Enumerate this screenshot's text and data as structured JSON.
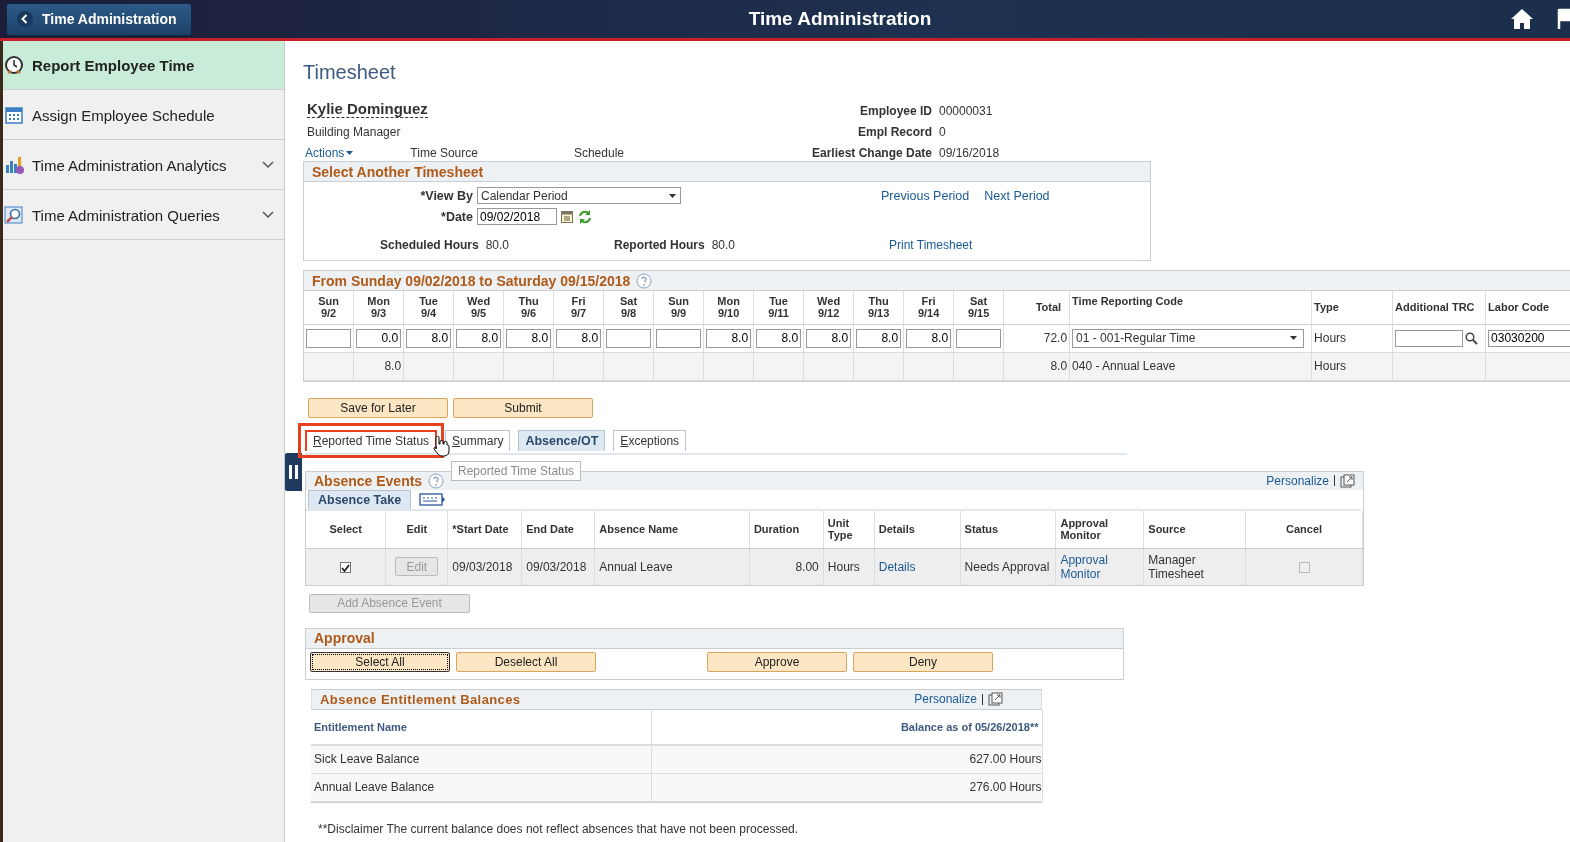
{
  "header": {
    "back_label": "Time Administration",
    "title": "Time Administration"
  },
  "sidebar": {
    "items": [
      {
        "label": "Report Employee Time",
        "selected": true,
        "expandable": false
      },
      {
        "label": "Assign Employee Schedule",
        "selected": false,
        "expandable": false
      },
      {
        "label": "Time Administration Analytics",
        "selected": false,
        "expandable": true
      },
      {
        "label": "Time Administration Queries",
        "selected": false,
        "expandable": true
      }
    ]
  },
  "page_title": "Timesheet",
  "employee": {
    "name": "Kylie Dominguez",
    "job_title": "Building Manager",
    "actions": "Actions",
    "time_source": "Time Source",
    "schedule": "Schedule",
    "fields": [
      {
        "label": "Employee ID",
        "value": "00000031"
      },
      {
        "label": "Empl Record",
        "value": "0"
      },
      {
        "label": "Earliest Change Date",
        "value": "09/16/2018"
      }
    ]
  },
  "select_timesheet": {
    "title": "Select Another Timesheet",
    "view_by_label": "*View By",
    "view_by": "Calendar Period",
    "date_label": "*Date",
    "date": "09/02/2018",
    "previous": "Previous Period",
    "next": "Next Period",
    "scheduled_label": "Scheduled Hours",
    "scheduled": "80.0",
    "reported_label": "Reported Hours",
    "reported": "80.0",
    "print": "Print Timesheet"
  },
  "grid": {
    "title": "From Sunday 09/02/2018 to Saturday 09/15/2018",
    "days": [
      {
        "dow": "Sun",
        "date": "9/2"
      },
      {
        "dow": "Mon",
        "date": "9/3"
      },
      {
        "dow": "Tue",
        "date": "9/4"
      },
      {
        "dow": "Wed",
        "date": "9/5"
      },
      {
        "dow": "Thu",
        "date": "9/6"
      },
      {
        "dow": "Fri",
        "date": "9/7"
      },
      {
        "dow": "Sat",
        "date": "9/8"
      },
      {
        "dow": "Sun",
        "date": "9/9"
      },
      {
        "dow": "Mon",
        "date": "9/10"
      },
      {
        "dow": "Tue",
        "date": "9/11"
      },
      {
        "dow": "Wed",
        "date": "9/12"
      },
      {
        "dow": "Thu",
        "date": "9/13"
      },
      {
        "dow": "Fri",
        "date": "9/14"
      },
      {
        "dow": "Sat",
        "date": "9/15"
      }
    ],
    "columns": [
      "Total",
      "Time Reporting Code",
      "Type",
      "Additional TRC",
      "Labor Code"
    ],
    "rows": [
      {
        "kind": "input",
        "hours": {
          "1": "0.0",
          "2": "8.0",
          "3": "8.0",
          "4": "8.0",
          "5": "8.0",
          "8": "8.0",
          "9": "8.0",
          "10": "8.0",
          "11": "8.0",
          "12": "8.0"
        },
        "total": "72.0",
        "trc": "01 - 001-Regular Time",
        "type": "Hours",
        "labor_code": "03030200"
      },
      {
        "kind": "readonly",
        "hours": {
          "1": "8.0"
        },
        "total": "8.0",
        "trc": "040 - Annual Leave",
        "type": "Hours"
      }
    ]
  },
  "buttons": [
    "Save for Later",
    "Submit"
  ],
  "tabs": [
    {
      "label": "Reported Time Status",
      "selected": false,
      "highlighted": true
    },
    {
      "label": "Summary",
      "selected": false,
      "highlighted": false
    },
    {
      "label": "Absence/OT",
      "selected": true,
      "highlighted": false
    },
    {
      "label": "Exceptions",
      "selected": false,
      "highlighted": false
    }
  ],
  "tooltip": "Reported Time Status",
  "absence_events": {
    "title": "Absence Events",
    "personalize": "Personalize",
    "subtab": "Absence Take",
    "columns": [
      "Select",
      "Edit",
      "*Start Date",
      "End Date",
      "Absence Name",
      "Duration",
      "Unit Type",
      "Details",
      "Status",
      "Approval Monitor",
      "Source",
      "Cancel"
    ],
    "rows": [
      {
        "selected": true,
        "edit": "Edit",
        "start": "09/03/2018",
        "end": "09/03/2018",
        "name": "Annual Leave",
        "duration": "8.00",
        "unit": "Hours",
        "details": "Details",
        "status": "Needs Approval",
        "monitor": "Approval Monitor",
        "source": "Manager Timesheet",
        "cancel": false
      }
    ]
  },
  "add_absence": {
    "label": "Add Absence Event",
    "disabled": true
  },
  "approval": {
    "title": "Approval",
    "buttons": [
      {
        "label": "Select All",
        "focused": true
      },
      {
        "label": "Deselect All",
        "focused": false
      },
      {
        "label": "Approve",
        "focused": false
      },
      {
        "label": "Deny",
        "focused": false
      }
    ]
  },
  "balances": {
    "title": "Absence Entitlement Balances",
    "personalize": "Personalize",
    "columns": [
      "Entitlement Name",
      "Balance as of 05/26/2018**"
    ],
    "rows": [
      {
        "name": "Sick Leave Balance",
        "balance": "627.00 Hours"
      },
      {
        "name": "Annual Leave Balance",
        "balance": "276.00 Hours"
      }
    ]
  },
  "disclaimer": "**Disclaimer  The current balance does not reflect absences that have not been processed."
}
